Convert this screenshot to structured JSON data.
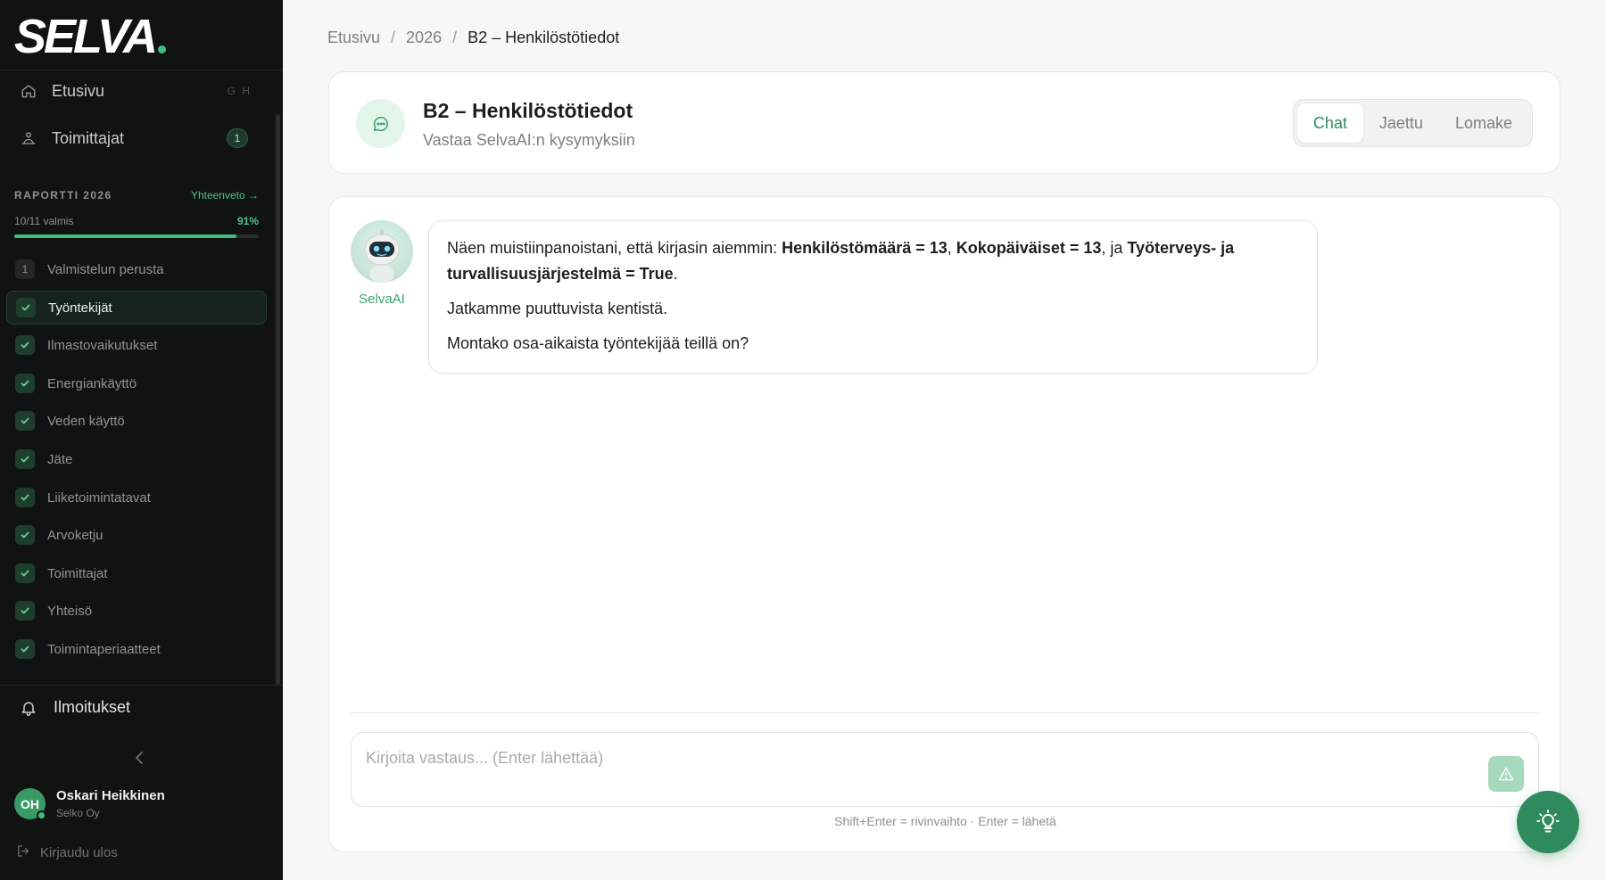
{
  "brand": {
    "name": "SELVA"
  },
  "sidebar": {
    "nav": [
      {
        "label": "Etusivu",
        "shortcut": "G H",
        "icon": "home-icon"
      },
      {
        "label": "Toimittajat",
        "badge": "1",
        "icon": "supplier-icon"
      }
    ],
    "report": {
      "title": "RAPORTTI 2026",
      "summary_link": "Yhteenveto →",
      "progress_label": "10/11 valmis",
      "progress_percent": "91%",
      "progress_fraction": 0.91
    },
    "steps": [
      {
        "marker": "1",
        "label": "Valmistelun perusta",
        "state": "todo"
      },
      {
        "label": "Työntekijät",
        "state": "done",
        "active": true
      },
      {
        "label": "Ilmastovaikutukset",
        "state": "done"
      },
      {
        "label": "Energiankäyttö",
        "state": "done"
      },
      {
        "label": "Veden käyttö",
        "state": "done"
      },
      {
        "label": "Jäte",
        "state": "done"
      },
      {
        "label": "Liiketoimintatavat",
        "state": "done"
      },
      {
        "label": "Arvoketju",
        "state": "done"
      },
      {
        "label": "Toimittajat",
        "state": "done"
      },
      {
        "label": "Yhteisö",
        "state": "done"
      },
      {
        "label": "Toimintaperiaatteet",
        "state": "done"
      }
    ],
    "notifications_label": "Ilmoitukset",
    "user": {
      "initials": "OH",
      "name": "Oskari Heikkinen",
      "company": "Selko Oy"
    },
    "logout_label": "Kirjaudu ulos"
  },
  "breadcrumb": {
    "items": [
      "Etusivu",
      "2026"
    ],
    "separator": "/",
    "current": "B2 – Henkilöstötiedot"
  },
  "header": {
    "title": "B2 – Henkilöstötiedot",
    "subtitle": "Vastaa SelvaAI:n kysymyksiin",
    "tabs": [
      {
        "label": "Chat",
        "active": true
      },
      {
        "label": "Jaettu",
        "active": false
      },
      {
        "label": "Lomake",
        "active": false
      }
    ]
  },
  "chat": {
    "bot_name": "SelvaAI",
    "message": {
      "intro": "Näen muistiinpanoistani, että kirjasin aiemmin: ",
      "item1": "Henkilöstömäärä = 13",
      "sep1": ", ",
      "item2": "Kokopäiväiset = 13",
      "sep2": ", ja ",
      "item3": "Työterveys- ja turvallisuusjärjestelmä = True",
      "end": ".",
      "line2": "Jatkamme puuttuvista kentistä.",
      "line3": "Montako osa-aikaista työntekijää teillä on?"
    },
    "input_placeholder": "Kirjoita vastaus... (Enter lähettää)",
    "hint": "Shift+Enter = rivinvaihto · Enter = lähetä"
  },
  "colors": {
    "accent": "#2f8a5d",
    "accent_bright": "#3ec27a",
    "sidebar_bg": "#111312",
    "page_bg": "#f6f7f6"
  }
}
